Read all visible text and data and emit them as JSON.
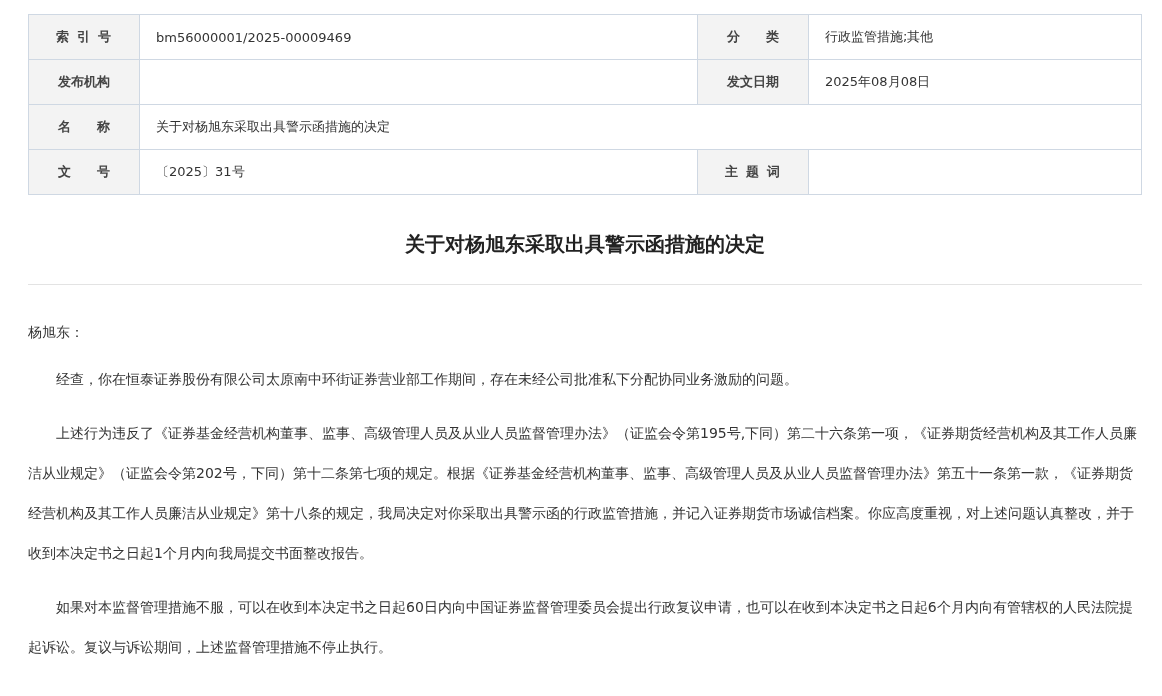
{
  "info_table": {
    "rows": [
      {
        "fields": [
          {
            "label": "索引号",
            "value": "bm56000001/2025-00009469"
          },
          {
            "label": "分类",
            "value": "行政监管措施;其他"
          }
        ]
      },
      {
        "fields": [
          {
            "label": "发布机构"
          },
          {
            "label": "发文日期",
            "value": "2025年08月08日"
          }
        ]
      },
      {
        "fields": [
          {
            "label": "名称",
            "value": "关于对杨旭东采取出具警示函措施的决定"
          }
        ]
      },
      {
        "fields": [
          {
            "label": "文号",
            "value": "〔2025〕31号"
          },
          {
            "label": "主题词"
          }
        ]
      }
    ]
  },
  "document": {
    "title": "关于对杨旭东采取出具警示函措施的决定",
    "salutation": "杨旭东：",
    "paragraphs": [
      "经查，你在恒泰证券股份有限公司太原南中环街证券营业部工作期间，存在未经公司批准私下分配协同业务激励的问题。",
      "上述行为违反了《证券基金经营机构董事、监事、高级管理人员及从业人员监督管理办法》（证监会令第195号,下同）第二十六条第一项，《证券期货经营机构及其工作人员廉洁从业规定》（证监会令第202号，下同）第十二条第七项的规定。根据《证券基金经营机构董事、监事、高级管理人员及从业人员监督管理办法》第五十一条第一款，《证券期货经营机构及其工作人员廉洁从业规定》第十八条的规定，我局决定对你采取出具警示函的行政监管措施，并记入证券期货市场诚信档案。你应高度重视，对上述问题认真整改，并于收到本决定书之日起1个月内向我局提交书面整改报告。",
      "如果对本监督管理措施不服，可以在收到本决定书之日起60日内向中国证券监督管理委员会提出行政复议申请，也可以在收到本决定书之日起6个月内向有管辖权的人民法院提起诉讼。复议与诉讼期间，上述监督管理措施不停止执行。"
    ]
  }
}
